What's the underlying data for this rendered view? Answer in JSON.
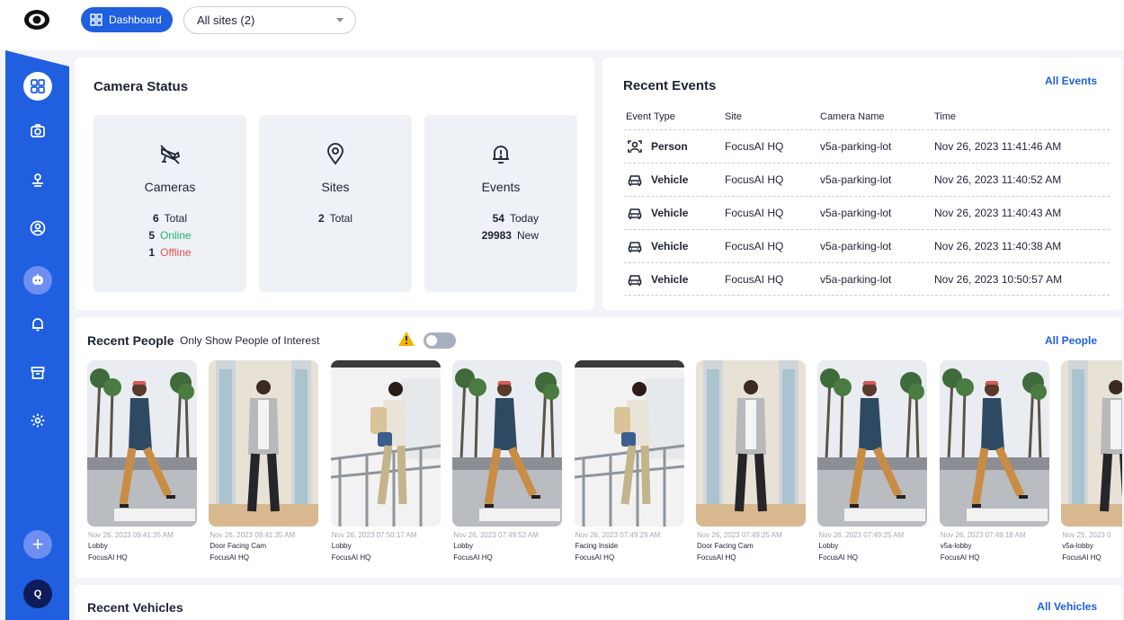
{
  "header": {
    "dashboard_label": "Dashboard",
    "site_selector": "All sites (2)"
  },
  "colors": {
    "primary": "#1f5fe0",
    "online": "#26b36e",
    "offline": "#e05353"
  },
  "sidebar": {
    "items": [
      {
        "icon": "dashboard-icon",
        "active": true
      },
      {
        "icon": "camera-icon"
      },
      {
        "icon": "location-icon"
      },
      {
        "icon": "person-icon"
      },
      {
        "icon": "robot-icon"
      },
      {
        "icon": "bell-icon"
      },
      {
        "icon": "archive-icon"
      },
      {
        "icon": "gear-icon"
      },
      {
        "icon": "plus-icon"
      }
    ],
    "avatar_initial": "Q"
  },
  "camera_status": {
    "title": "Camera Status",
    "cameras": {
      "label": "Cameras",
      "total": "6",
      "total_label": "Total",
      "online": "5",
      "online_label": "Online",
      "offline": "1",
      "offline_label": "Offline"
    },
    "sites": {
      "label": "Sites",
      "total": "2",
      "total_label": "Total"
    },
    "events": {
      "label": "Events",
      "today": "54",
      "today_label": "Today",
      "new": "29983",
      "new_label": "New"
    }
  },
  "recent_events": {
    "title": "Recent Events",
    "all_link": "All Events",
    "columns": [
      "Event Type",
      "Site",
      "Camera Name",
      "Time"
    ],
    "rows": [
      {
        "type": "Person",
        "icon": "person-scan-icon",
        "site": "FocusAI HQ",
        "camera": "v5a-parking-lot",
        "time": "Nov 26, 2023 11:41:46 AM"
      },
      {
        "type": "Vehicle",
        "icon": "car-icon",
        "site": "FocusAI HQ",
        "camera": "v5a-parking-lot",
        "time": "Nov 26, 2023 11:40:52 AM"
      },
      {
        "type": "Vehicle",
        "icon": "car-icon",
        "site": "FocusAI HQ",
        "camera": "v5a-parking-lot",
        "time": "Nov 26, 2023 11:40:43 AM"
      },
      {
        "type": "Vehicle",
        "icon": "car-icon",
        "site": "FocusAI HQ",
        "camera": "v5a-parking-lot",
        "time": "Nov 26, 2023 11:40:38 AM"
      },
      {
        "type": "Vehicle",
        "icon": "car-icon",
        "site": "FocusAI HQ",
        "camera": "v5a-parking-lot",
        "time": "Nov 26, 2023 10:50:57 AM"
      }
    ]
  },
  "recent_people": {
    "title": "Recent People",
    "filter_label": "Only Show People of Interest",
    "filter_on": false,
    "all_link": "All People",
    "items": [
      {
        "time": "Nov 26, 2023 09:41:35 AM",
        "camera": "Lobby",
        "site": "FocusAI HQ",
        "scene": "street"
      },
      {
        "time": "Nov 26, 2023 09:41:35 AM",
        "camera": "Door Facing Cam",
        "site": "FocusAI HQ",
        "scene": "hallway"
      },
      {
        "time": "Nov 26, 2023 07:50:17 AM",
        "camera": "Lobby",
        "site": "FocusAI HQ",
        "scene": "rail"
      },
      {
        "time": "Nov 26, 2023 07:49:52 AM",
        "camera": "Lobby",
        "site": "FocusAI HQ",
        "scene": "street"
      },
      {
        "time": "Nov 26, 2023 07:49:29 AM",
        "camera": "Facing Inside",
        "site": "FocusAI HQ",
        "scene": "rail"
      },
      {
        "time": "Nov 26, 2023 07:49:25 AM",
        "camera": "Door Facing Cam",
        "site": "FocusAI HQ",
        "scene": "hallway"
      },
      {
        "time": "Nov 26, 2023 07:49:25 AM",
        "camera": "Lobby",
        "site": "FocusAI HQ",
        "scene": "street"
      },
      {
        "time": "Nov 26, 2023 07:49:18 AM",
        "camera": "v5a-lobby",
        "site": "FocusAI HQ",
        "scene": "street"
      },
      {
        "time": "Nov 25, 2023 0",
        "camera": "v5a-lobby",
        "site": "FocusAI HQ",
        "scene": "hallway"
      }
    ]
  },
  "recent_vehicles": {
    "title": "Recent Vehicles",
    "all_link": "All Vehicles"
  }
}
